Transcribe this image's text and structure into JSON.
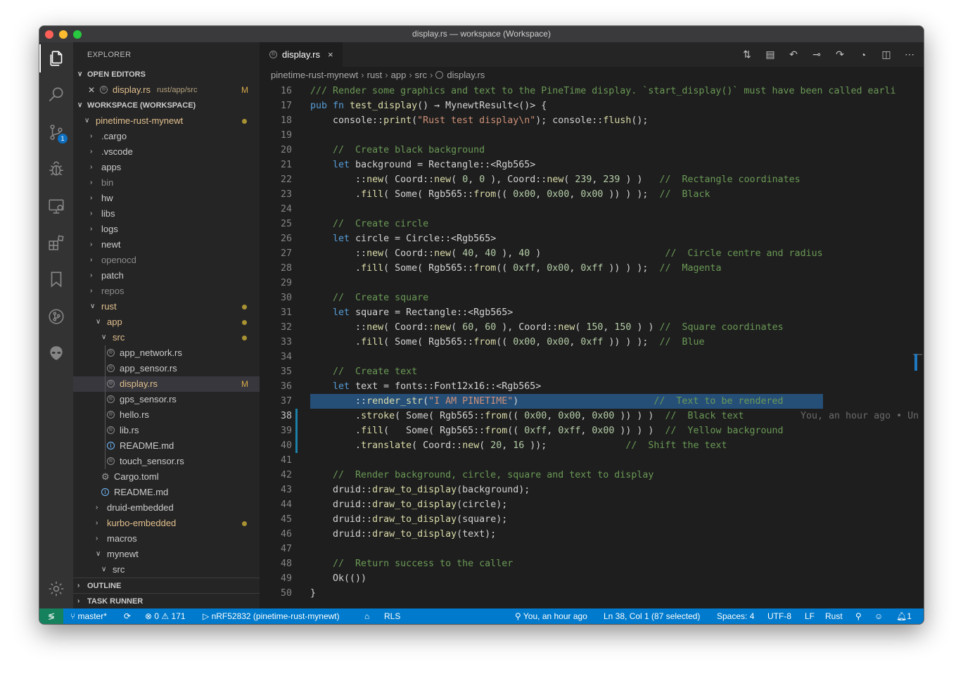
{
  "window": {
    "title": "display.rs — workspace (Workspace)"
  },
  "sidebar": {
    "title": "EXPLORER",
    "open_editors_label": "OPEN EDITORS",
    "open_editor": {
      "name": "display.rs",
      "path": "rust/app/src",
      "status": "M"
    },
    "workspace_label": "WORKSPACE (WORKSPACE)",
    "tree": [
      {
        "name": "pinetime-rust-mynewt",
        "indent": 1,
        "type": "folder",
        "open": true,
        "modified": true,
        "dot": true
      },
      {
        "name": ".cargo",
        "indent": 2,
        "type": "folder",
        "open": false
      },
      {
        "name": ".vscode",
        "indent": 2,
        "type": "folder",
        "open": false
      },
      {
        "name": "apps",
        "indent": 2,
        "type": "folder",
        "open": false
      },
      {
        "name": "bin",
        "indent": 2,
        "type": "folder",
        "open": false,
        "dim": true
      },
      {
        "name": "hw",
        "indent": 2,
        "type": "folder",
        "open": false
      },
      {
        "name": "libs",
        "indent": 2,
        "type": "folder",
        "open": false
      },
      {
        "name": "logs",
        "indent": 2,
        "type": "folder",
        "open": false
      },
      {
        "name": "newt",
        "indent": 2,
        "type": "folder",
        "open": false
      },
      {
        "name": "openocd",
        "indent": 2,
        "type": "folder",
        "open": false,
        "dim": true
      },
      {
        "name": "patch",
        "indent": 2,
        "type": "folder",
        "open": false
      },
      {
        "name": "repos",
        "indent": 2,
        "type": "folder",
        "open": false,
        "dim": true
      },
      {
        "name": "rust",
        "indent": 2,
        "type": "folder",
        "open": true,
        "modified": true,
        "dot": true
      },
      {
        "name": "app",
        "indent": 3,
        "type": "folder",
        "open": true,
        "modified": true,
        "dot": true
      },
      {
        "name": "src",
        "indent": 4,
        "type": "folder",
        "open": true,
        "modified": true,
        "dot": true
      },
      {
        "name": "app_network.rs",
        "indent": 5,
        "type": "rs"
      },
      {
        "name": "app_sensor.rs",
        "indent": 5,
        "type": "rs"
      },
      {
        "name": "display.rs",
        "indent": 5,
        "type": "rs",
        "modified": true,
        "status": "M",
        "selected": true
      },
      {
        "name": "gps_sensor.rs",
        "indent": 5,
        "type": "rs"
      },
      {
        "name": "hello.rs",
        "indent": 5,
        "type": "rs"
      },
      {
        "name": "lib.rs",
        "indent": 5,
        "type": "rs"
      },
      {
        "name": "README.md",
        "indent": 5,
        "type": "info"
      },
      {
        "name": "touch_sensor.rs",
        "indent": 5,
        "type": "rs"
      },
      {
        "name": "Cargo.toml",
        "indent": 4,
        "type": "gear"
      },
      {
        "name": "README.md",
        "indent": 4,
        "type": "info"
      },
      {
        "name": "druid-embedded",
        "indent": 3,
        "type": "folder",
        "open": false
      },
      {
        "name": "kurbo-embedded",
        "indent": 3,
        "type": "folder",
        "open": false,
        "modified": true,
        "dot": true
      },
      {
        "name": "macros",
        "indent": 3,
        "type": "folder",
        "open": false
      },
      {
        "name": "mynewt",
        "indent": 3,
        "type": "folder",
        "open": true
      },
      {
        "name": "src",
        "indent": 4,
        "type": "folder",
        "open": true
      }
    ],
    "outline_label": "OUTLINE",
    "task_runner_label": "TASK RUNNER"
  },
  "editor": {
    "tab": {
      "name": "display.rs",
      "close": "×"
    },
    "breadcrumb": [
      "pinetime-rust-mynewt",
      "rust",
      "app",
      "src",
      "display.rs"
    ],
    "highlight_line": 37,
    "current_line": 38,
    "blame": "You, an hour ago • Un",
    "lines": [
      {
        "n": 16,
        "tokens": [
          [
            "c-cmt",
            "/// Render some graphics and text to the PineTime display. `start_display()` must have been called earli"
          ]
        ]
      },
      {
        "n": 17,
        "tokens": [
          [
            "c-kw",
            "pub"
          ],
          [
            "",
            " "
          ],
          [
            "c-kw",
            "fn"
          ],
          [
            "",
            " "
          ],
          [
            "c-fn",
            "test_display"
          ],
          [
            "",
            "() → MynewtResult<()> {"
          ]
        ]
      },
      {
        "n": 18,
        "tokens": [
          [
            "",
            "    console::"
          ],
          [
            "c-fn",
            "print"
          ],
          [
            "",
            "("
          ],
          [
            "c-str",
            "\"Rust test display\\n\""
          ],
          [
            "",
            "); console::"
          ],
          [
            "c-fn",
            "flush"
          ],
          [
            "",
            "();"
          ]
        ]
      },
      {
        "n": 19,
        "tokens": []
      },
      {
        "n": 20,
        "tokens": [
          [
            "",
            "    "
          ],
          [
            "c-cmt",
            "//  Create black background"
          ]
        ]
      },
      {
        "n": 21,
        "tokens": [
          [
            "",
            "    "
          ],
          [
            "c-kw",
            "let"
          ],
          [
            "",
            " background = Rectangle::<Rgb565>"
          ]
        ]
      },
      {
        "n": 22,
        "tokens": [
          [
            "",
            "        ::"
          ],
          [
            "c-fn",
            "new"
          ],
          [
            "",
            "( Coord::"
          ],
          [
            "c-fn",
            "new"
          ],
          [
            "",
            "( "
          ],
          [
            "c-num",
            "0"
          ],
          [
            "",
            ", "
          ],
          [
            "c-num",
            "0"
          ],
          [
            "",
            " ), Coord::"
          ],
          [
            "c-fn",
            "new"
          ],
          [
            "",
            "( "
          ],
          [
            "c-num",
            "239"
          ],
          [
            "",
            ", "
          ],
          [
            "c-num",
            "239"
          ],
          [
            "",
            " ) )   "
          ],
          [
            "c-cmt",
            "//  Rectangle coordinates"
          ]
        ]
      },
      {
        "n": 23,
        "tokens": [
          [
            "",
            "        ."
          ],
          [
            "c-fn",
            "fill"
          ],
          [
            "",
            "( Some( Rgb565::"
          ],
          [
            "c-fn",
            "from"
          ],
          [
            "",
            "(( "
          ],
          [
            "c-num",
            "0x00"
          ],
          [
            "",
            ", "
          ],
          [
            "c-num",
            "0x00"
          ],
          [
            "",
            ", "
          ],
          [
            "c-num",
            "0x00"
          ],
          [
            "",
            " )) ) );  "
          ],
          [
            "c-cmt",
            "//  Black"
          ]
        ]
      },
      {
        "n": 24,
        "tokens": []
      },
      {
        "n": 25,
        "tokens": [
          [
            "",
            "    "
          ],
          [
            "c-cmt",
            "//  Create circle"
          ]
        ]
      },
      {
        "n": 26,
        "tokens": [
          [
            "",
            "    "
          ],
          [
            "c-kw",
            "let"
          ],
          [
            "",
            " circle = Circle::<Rgb565>"
          ]
        ]
      },
      {
        "n": 27,
        "tokens": [
          [
            "",
            "        ::"
          ],
          [
            "c-fn",
            "new"
          ],
          [
            "",
            "( Coord::"
          ],
          [
            "c-fn",
            "new"
          ],
          [
            "",
            "( "
          ],
          [
            "c-num",
            "40"
          ],
          [
            "",
            ", "
          ],
          [
            "c-num",
            "40"
          ],
          [
            "",
            " ), "
          ],
          [
            "c-num",
            "40"
          ],
          [
            "",
            " )                      "
          ],
          [
            "c-cmt",
            "//  Circle centre and radius"
          ]
        ]
      },
      {
        "n": 28,
        "tokens": [
          [
            "",
            "        ."
          ],
          [
            "c-fn",
            "fill"
          ],
          [
            "",
            "( Some( Rgb565::"
          ],
          [
            "c-fn",
            "from"
          ],
          [
            "",
            "(( "
          ],
          [
            "c-num",
            "0xff"
          ],
          [
            "",
            ", "
          ],
          [
            "c-num",
            "0x00"
          ],
          [
            "",
            ", "
          ],
          [
            "c-num",
            "0xff"
          ],
          [
            "",
            " )) ) );  "
          ],
          [
            "c-cmt",
            "//  Magenta"
          ]
        ]
      },
      {
        "n": 29,
        "tokens": []
      },
      {
        "n": 30,
        "tokens": [
          [
            "",
            "    "
          ],
          [
            "c-cmt",
            "//  Create square"
          ]
        ]
      },
      {
        "n": 31,
        "tokens": [
          [
            "",
            "    "
          ],
          [
            "c-kw",
            "let"
          ],
          [
            "",
            " square = Rectangle::<Rgb565>"
          ]
        ]
      },
      {
        "n": 32,
        "tokens": [
          [
            "",
            "        ::"
          ],
          [
            "c-fn",
            "new"
          ],
          [
            "",
            "( Coord::"
          ],
          [
            "c-fn",
            "new"
          ],
          [
            "",
            "( "
          ],
          [
            "c-num",
            "60"
          ],
          [
            "",
            ", "
          ],
          [
            "c-num",
            "60"
          ],
          [
            "",
            " ), Coord::"
          ],
          [
            "c-fn",
            "new"
          ],
          [
            "",
            "( "
          ],
          [
            "c-num",
            "150"
          ],
          [
            "",
            ", "
          ],
          [
            "c-num",
            "150"
          ],
          [
            "",
            " ) ) "
          ],
          [
            "c-cmt",
            "//  Square coordinates"
          ]
        ]
      },
      {
        "n": 33,
        "tokens": [
          [
            "",
            "        ."
          ],
          [
            "c-fn",
            "fill"
          ],
          [
            "",
            "( Some( Rgb565::"
          ],
          [
            "c-fn",
            "from"
          ],
          [
            "",
            "(( "
          ],
          [
            "c-num",
            "0x00"
          ],
          [
            "",
            ", "
          ],
          [
            "c-num",
            "0x00"
          ],
          [
            "",
            ", "
          ],
          [
            "c-num",
            "0xff"
          ],
          [
            "",
            " )) ) );  "
          ],
          [
            "c-cmt",
            "//  Blue"
          ]
        ]
      },
      {
        "n": 34,
        "tokens": []
      },
      {
        "n": 35,
        "tokens": [
          [
            "",
            "    "
          ],
          [
            "c-cmt",
            "//  Create text"
          ]
        ]
      },
      {
        "n": 36,
        "tokens": [
          [
            "",
            "    "
          ],
          [
            "c-kw",
            "let"
          ],
          [
            "",
            " text = fonts::Font12x16::<Rgb565>"
          ]
        ]
      },
      {
        "n": 37,
        "tokens": [
          [
            "",
            "        ::"
          ],
          [
            "c-fn",
            "render_str"
          ],
          [
            "",
            "("
          ],
          [
            "c-str",
            "\"I AM PINETIME\""
          ],
          [
            "",
            ")                        "
          ],
          [
            "c-cmt",
            "//  Text to be rendered"
          ]
        ]
      },
      {
        "n": 38,
        "tokens": [
          [
            "",
            "        ."
          ],
          [
            "c-fn",
            "stroke"
          ],
          [
            "",
            "( Some( Rgb565::"
          ],
          [
            "c-fn",
            "from"
          ],
          [
            "",
            "(( "
          ],
          [
            "c-num",
            "0x00"
          ],
          [
            "",
            ", "
          ],
          [
            "c-num",
            "0x00"
          ],
          [
            "",
            ", "
          ],
          [
            "c-num",
            "0x00"
          ],
          [
            "",
            " )) ) )  "
          ],
          [
            "c-cmt",
            "//  Black text"
          ]
        ]
      },
      {
        "n": 39,
        "tokens": [
          [
            "",
            "        ."
          ],
          [
            "c-fn",
            "fill"
          ],
          [
            "",
            "(   Some( Rgb565::"
          ],
          [
            "c-fn",
            "from"
          ],
          [
            "",
            "(( "
          ],
          [
            "c-num",
            "0xff"
          ],
          [
            "",
            ", "
          ],
          [
            "c-num",
            "0xff"
          ],
          [
            "",
            ", "
          ],
          [
            "c-num",
            "0x00"
          ],
          [
            "",
            " )) ) )  "
          ],
          [
            "c-cmt",
            "//  Yellow background"
          ]
        ]
      },
      {
        "n": 40,
        "tokens": [
          [
            "",
            "        ."
          ],
          [
            "c-fn",
            "translate"
          ],
          [
            "",
            "( Coord::"
          ],
          [
            "c-fn",
            "new"
          ],
          [
            "",
            "( "
          ],
          [
            "c-num",
            "20"
          ],
          [
            "",
            ", "
          ],
          [
            "c-num",
            "16"
          ],
          [
            "",
            " ));              "
          ],
          [
            "c-cmt",
            "//  Shift the text"
          ]
        ]
      },
      {
        "n": 41,
        "tokens": []
      },
      {
        "n": 42,
        "tokens": [
          [
            "",
            "    "
          ],
          [
            "c-cmt",
            "//  Render background, circle, square and text to display"
          ]
        ]
      },
      {
        "n": 43,
        "tokens": [
          [
            "",
            "    druid::"
          ],
          [
            "c-fn",
            "draw_to_display"
          ],
          [
            "",
            "(background);"
          ]
        ]
      },
      {
        "n": 44,
        "tokens": [
          [
            "",
            "    druid::"
          ],
          [
            "c-fn",
            "draw_to_display"
          ],
          [
            "",
            "(circle);"
          ]
        ]
      },
      {
        "n": 45,
        "tokens": [
          [
            "",
            "    druid::"
          ],
          [
            "c-fn",
            "draw_to_display"
          ],
          [
            "",
            "(square);"
          ]
        ]
      },
      {
        "n": 46,
        "tokens": [
          [
            "",
            "    druid::"
          ],
          [
            "c-fn",
            "draw_to_display"
          ],
          [
            "",
            "(text);"
          ]
        ]
      },
      {
        "n": 47,
        "tokens": []
      },
      {
        "n": 48,
        "tokens": [
          [
            "",
            "    "
          ],
          [
            "c-cmt",
            "//  Return success to the caller"
          ]
        ]
      },
      {
        "n": 49,
        "tokens": [
          [
            "",
            "    Ok(())"
          ]
        ]
      },
      {
        "n": 50,
        "tokens": [
          [
            "",
            "}"
          ]
        ]
      }
    ]
  },
  "statusbar": {
    "branch": "master*",
    "errors": "0",
    "warnings": "171",
    "target": "nRF52832 (pinetime-rust-mynewt)",
    "rls": "RLS",
    "blame": "You, an hour ago",
    "position": "Ln 38, Col 1 (87 selected)",
    "spaces": "Spaces: 4",
    "encoding": "UTF-8",
    "eol": "LF",
    "language": "Rust",
    "notifications": "1"
  },
  "activity": {
    "scm_badge": "1"
  },
  "colors": {
    "accent": "#007acc",
    "remote": "#16825d",
    "selection": "#264f78",
    "modified": "#e2c08d"
  }
}
